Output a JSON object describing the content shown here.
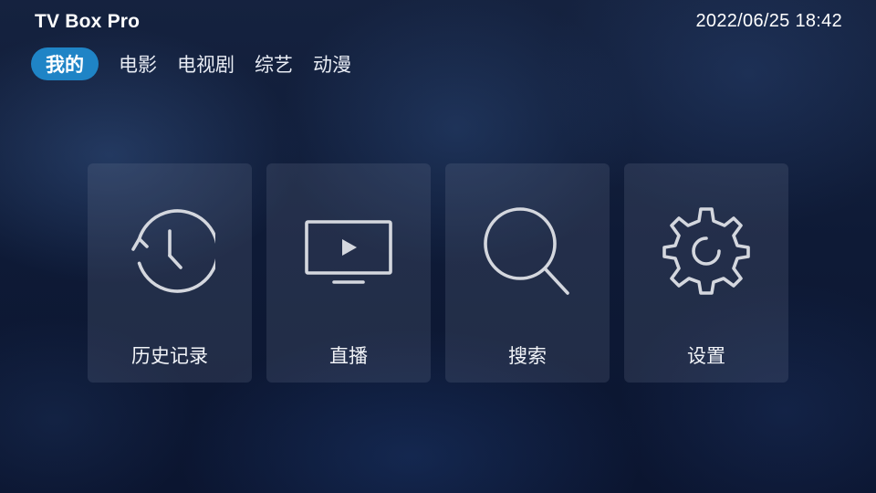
{
  "header": {
    "app_title": "TV Box Pro",
    "datetime": "2022/06/25 18:42"
  },
  "tabs": [
    {
      "label": "我的",
      "active": true
    },
    {
      "label": "电影",
      "active": false
    },
    {
      "label": "电视剧",
      "active": false
    },
    {
      "label": "综艺",
      "active": false
    },
    {
      "label": "动漫",
      "active": false
    }
  ],
  "tiles": [
    {
      "label": "历史记录",
      "icon": "history-icon"
    },
    {
      "label": "直播",
      "icon": "tv-play-icon"
    },
    {
      "label": "搜索",
      "icon": "search-icon"
    },
    {
      "label": "设置",
      "icon": "gear-icon"
    }
  ],
  "colors": {
    "accent": "#1f84c6",
    "background": "#0f1a33",
    "icon_stroke": "#d4d7de"
  }
}
